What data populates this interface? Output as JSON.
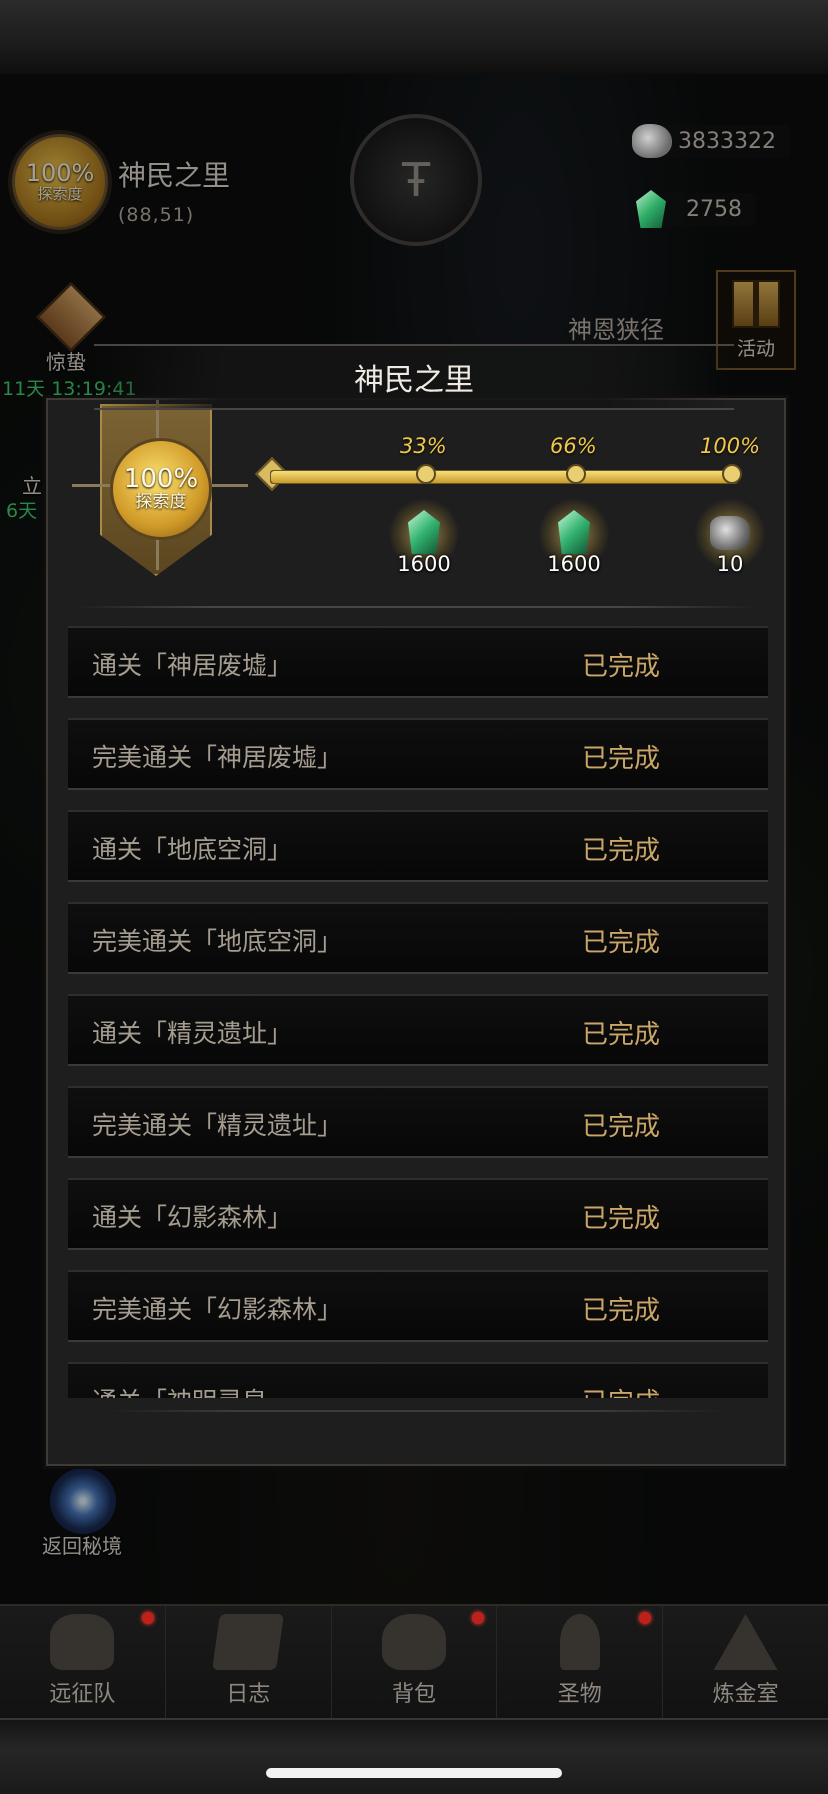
{
  "hud": {
    "exploration_pct": "100%",
    "exploration_label": "探索度",
    "region_name": "神民之里",
    "region_coords": "(88,51)",
    "currency_stone": "3833322",
    "currency_gem": "2758",
    "gift_label": "惊蛰",
    "gift_timer": "11天 13:19:41",
    "side_label_2": "立",
    "side_timer_2": "6天",
    "activity_label": "活动",
    "location_label": "神恩狭径",
    "return_label": "返回秘境"
  },
  "modal": {
    "title": "神民之里",
    "exploration_pct": "100%",
    "exploration_label": "探索度",
    "progress_fraction": 1.0,
    "milestones": [
      {
        "pct": "33%",
        "reward_icon": "green-gem-icon",
        "qty": "1600"
      },
      {
        "pct": "66%",
        "reward_icon": "green-gem-icon",
        "qty": "1600"
      },
      {
        "pct": "100%",
        "reward_icon": "ore-icon",
        "qty": "10"
      }
    ],
    "tasks": [
      {
        "name": "通关「神居废墟」",
        "status": "已完成"
      },
      {
        "name": "完美通关「神居废墟」",
        "status": "已完成"
      },
      {
        "name": "通关「地底空洞」",
        "status": "已完成"
      },
      {
        "name": "完美通关「地底空洞」",
        "status": "已完成"
      },
      {
        "name": "通关「精灵遗址」",
        "status": "已完成"
      },
      {
        "name": "完美通关「精灵遗址」",
        "status": "已完成"
      },
      {
        "name": "通关「幻影森林」",
        "status": "已完成"
      },
      {
        "name": "完美通关「幻影森林」",
        "status": "已完成"
      },
      {
        "name": "通关「神明灵泉",
        "status": "已完成"
      }
    ]
  },
  "nav": [
    {
      "label": "远征队",
      "icon": "helmet-icon",
      "badge": true
    },
    {
      "label": "日志",
      "icon": "scroll-icon",
      "badge": false
    },
    {
      "label": "背包",
      "icon": "bag-icon",
      "badge": true
    },
    {
      "label": "圣物",
      "icon": "relic-icon",
      "badge": true
    },
    {
      "label": "炼金室",
      "icon": "alchemy-icon",
      "badge": false
    }
  ],
  "colors": {
    "accent_gold": "#f1c84a",
    "status_done": "#caa668",
    "timer_green": "#3fd070",
    "badge_red": "#c0201a"
  }
}
